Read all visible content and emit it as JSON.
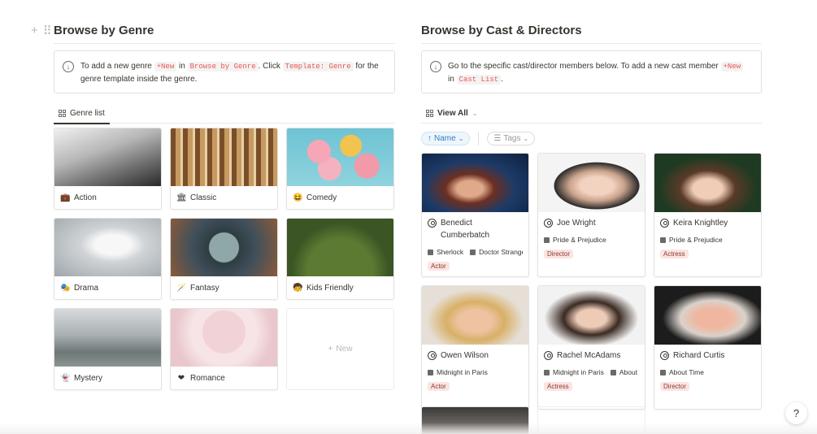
{
  "genre_section": {
    "title": "Browse by Genre",
    "callout": {
      "t1": "To add a new genre ",
      "code1": "+New",
      "t2": " in ",
      "code2": "Browse by Genre",
      "t3": ". Click ",
      "code3": "Template: Genre",
      "t4": " for the genre template inside the genre."
    },
    "tab_label": "Genre list",
    "genres": [
      {
        "label": "Action",
        "icon": "briefcase-icon"
      },
      {
        "label": "Classic",
        "icon": "museum-icon"
      },
      {
        "label": "Comedy",
        "icon": "laughing-face-icon"
      },
      {
        "label": "Drama",
        "icon": "masks-icon"
      },
      {
        "label": "Fantasy",
        "icon": "magic-wand-icon"
      },
      {
        "label": "Kids Friendly",
        "icon": "kid-icon"
      },
      {
        "label": "Mystery",
        "icon": "ghost-icon"
      },
      {
        "label": "Romance",
        "icon": "heart-icon"
      }
    ],
    "new_label": "New"
  },
  "cast_section": {
    "title": "Browse by Cast & Directors",
    "callout": {
      "t1": "Go to the specific cast/director members below. To add a new cast member ",
      "code1": "+New",
      "t2": " in ",
      "code2": "Cast List",
      "t3": "."
    },
    "view_label": "View All",
    "filters": {
      "name": "Name",
      "tags": "Tags"
    },
    "cast": [
      {
        "name": "Benedict Cumberbatch",
        "rels": [
          "Sherlock",
          "Doctor Strange"
        ],
        "tag": "Actor"
      },
      {
        "name": "Joe Wright",
        "rels": [
          "Pride & Prejudice"
        ],
        "tag": "Director"
      },
      {
        "name": "Keira Knightley",
        "rels": [
          "Pride & Prejudice"
        ],
        "tag": "Actress"
      },
      {
        "name": "Owen Wilson",
        "rels": [
          "Midnight in Paris"
        ],
        "tag": "Actor"
      },
      {
        "name": "Rachel McAdams",
        "rels": [
          "Midnight in Paris",
          "About"
        ],
        "tag": "Actress"
      },
      {
        "name": "Richard Curtis",
        "rels": [
          "About Time"
        ],
        "tag": "Director"
      }
    ]
  },
  "help_label": "?"
}
